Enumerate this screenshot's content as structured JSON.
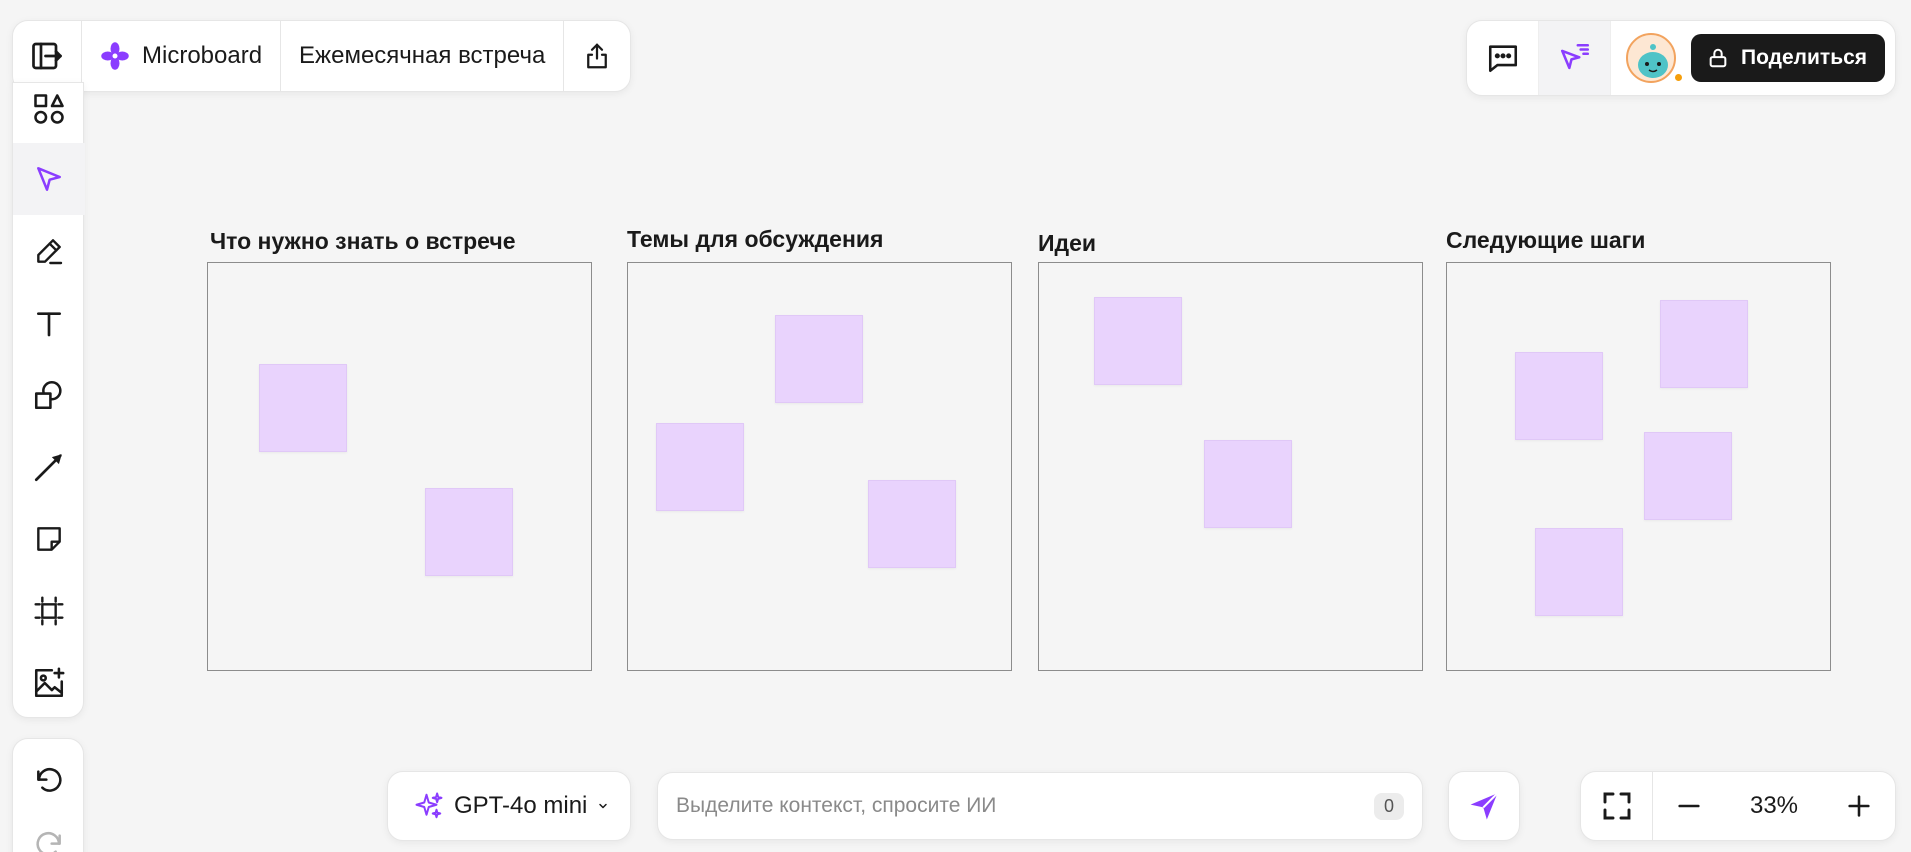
{
  "header": {
    "brand_name": "Microboard",
    "board_title": "Ежемесячная встреча"
  },
  "top_right": {
    "share_label": "Поделиться"
  },
  "frames": [
    {
      "title": "Что нужно знать о встрече"
    },
    {
      "title": "Темы для обсуждения"
    },
    {
      "title": "Идеи"
    },
    {
      "title": "Следующие шаги"
    }
  ],
  "ai": {
    "model": "GPT-4o mini",
    "placeholder": "Выделите контекст, спросите ИИ",
    "counter": "0"
  },
  "zoom": {
    "level": "33%"
  },
  "colors": {
    "accent": "#8b3dff",
    "sticky": "#e9d3fd",
    "share_button": "#1a1a1a"
  },
  "icons": {
    "sidebar_toggle": "panel-arrow-icon",
    "brand": "four-petal-logo-icon",
    "export": "share-upload-icon",
    "comments": "comment-icon",
    "presence": "cursor-follow-icon",
    "lock": "lock-icon"
  }
}
